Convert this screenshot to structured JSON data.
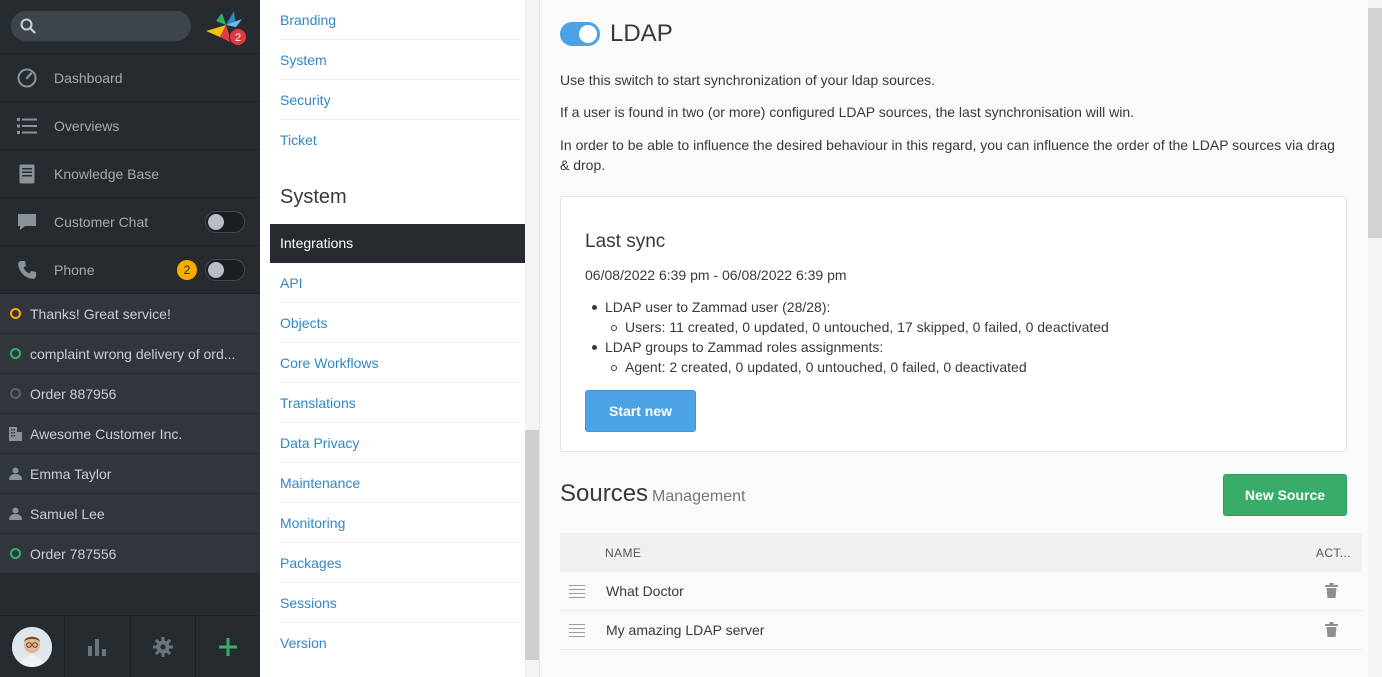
{
  "nav": {
    "search_placeholder": "",
    "logo_badge": "2",
    "items": [
      {
        "label": "Dashboard"
      },
      {
        "label": "Overviews"
      },
      {
        "label": "Knowledge Base"
      },
      {
        "label": "Customer Chat"
      },
      {
        "label": "Phone",
        "badge": "2"
      }
    ],
    "tasks": [
      {
        "label": "Thanks! Great service!",
        "icon": "ticket-open-icon",
        "status": "pending"
      },
      {
        "label": "complaint wrong delivery of ord...",
        "icon": "ticket-open-icon",
        "status": "open"
      },
      {
        "label": "Order 887956",
        "icon": "ticket-closed-icon",
        "status": "closed"
      },
      {
        "label": "Awesome Customer Inc.",
        "icon": "organization-icon"
      },
      {
        "label": "Emma Taylor",
        "icon": "user-icon"
      },
      {
        "label": "Samuel Lee",
        "icon": "user-icon"
      },
      {
        "label": "Order 787556",
        "icon": "ticket-open-icon",
        "status": "open"
      }
    ]
  },
  "subnav": {
    "top_links": [
      "Branding",
      "System",
      "Security",
      "Ticket"
    ],
    "heading": "System",
    "active": "Integrations",
    "links": [
      "API",
      "Objects",
      "Core Workflows",
      "Translations",
      "Data Privacy",
      "Maintenance",
      "Monitoring",
      "Packages",
      "Sessions",
      "Version"
    ]
  },
  "main": {
    "title": "LDAP",
    "enabled": true,
    "descriptions": [
      "Use this switch to start synchronization of your ldap sources.",
      "If a user is found in two (or more) configured LDAP sources, the last synchronisation will win.",
      "In order to be able to influence the desired behaviour in this regard, you can influence the order of the LDAP sources via drag & drop."
    ],
    "last_sync": {
      "title": "Last sync",
      "range": "06/08/2022 6:39 pm - 06/08/2022 6:39 pm",
      "users_heading": "LDAP user to Zammad user (28/28):",
      "users_detail": "Users: 11 created, 0 updated, 0 untouched, 17 skipped, 0 failed, 0 deactivated",
      "groups_heading": "LDAP groups to Zammad roles assignments:",
      "groups_detail": "Agent: 2 created, 0 updated, 0 untouched, 0 failed, 0 deactivated",
      "button": "Start new"
    },
    "sources": {
      "title": "Sources",
      "subtitle": "Management",
      "new_button": "New Source",
      "col_name": "NAME",
      "col_actions": "ACT...",
      "rows": [
        "What Doctor",
        "My amazing LDAP server"
      ]
    }
  },
  "colors": {
    "nav_bg": "#262b30",
    "link_blue": "#2f87c7",
    "primary_blue": "#4ba3e6",
    "success_green": "#38ad69",
    "badge_yellow": "#faab00",
    "badge_red": "#e2383f"
  }
}
